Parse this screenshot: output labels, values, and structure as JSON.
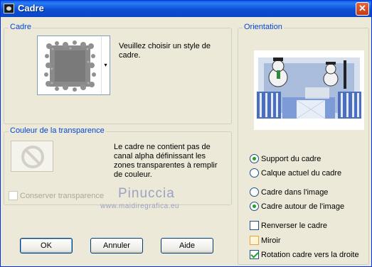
{
  "window": {
    "title": "Cadre",
    "close_symbol": "✕"
  },
  "cadre_group": {
    "label": "Cadre",
    "instruction": "Veuillez choisir un style de cadre.",
    "dropdown_arrow": "▾"
  },
  "transparency_group": {
    "label": "Couleur de la transparence",
    "message": "Le cadre ne contient pas de canal alpha définissant les zones transparentes à remplir de couleur.",
    "preserve_checkbox": {
      "label": "Conserver transparence",
      "checked": false,
      "disabled": true
    }
  },
  "orientation_group": {
    "label": "Orientation",
    "support_options": [
      {
        "label": "Support du cadre",
        "checked": true
      },
      {
        "label": "Calque actuel du cadre",
        "checked": false
      }
    ],
    "placement_options": [
      {
        "label": "Cadre dans l'image",
        "checked": false
      },
      {
        "label": "Cadre autour de l'image",
        "checked": true
      }
    ],
    "checkboxes": [
      {
        "label": "Renverser le cadre",
        "checked": false
      },
      {
        "label": "Miroir",
        "checked": false
      },
      {
        "label": "Rotation cadre vers la droite",
        "checked": true
      }
    ]
  },
  "watermark": {
    "name": "Pinuccia",
    "url": "www.maidiregrafica.eu"
  },
  "buttons": {
    "ok": "OK",
    "cancel": "Annuler",
    "help": "Aide"
  },
  "colors": {
    "title_blue": "#0a4fd6",
    "group_label": "#0046d5",
    "dialog_bg": "#ece9d8",
    "check_green": "#21a121"
  }
}
